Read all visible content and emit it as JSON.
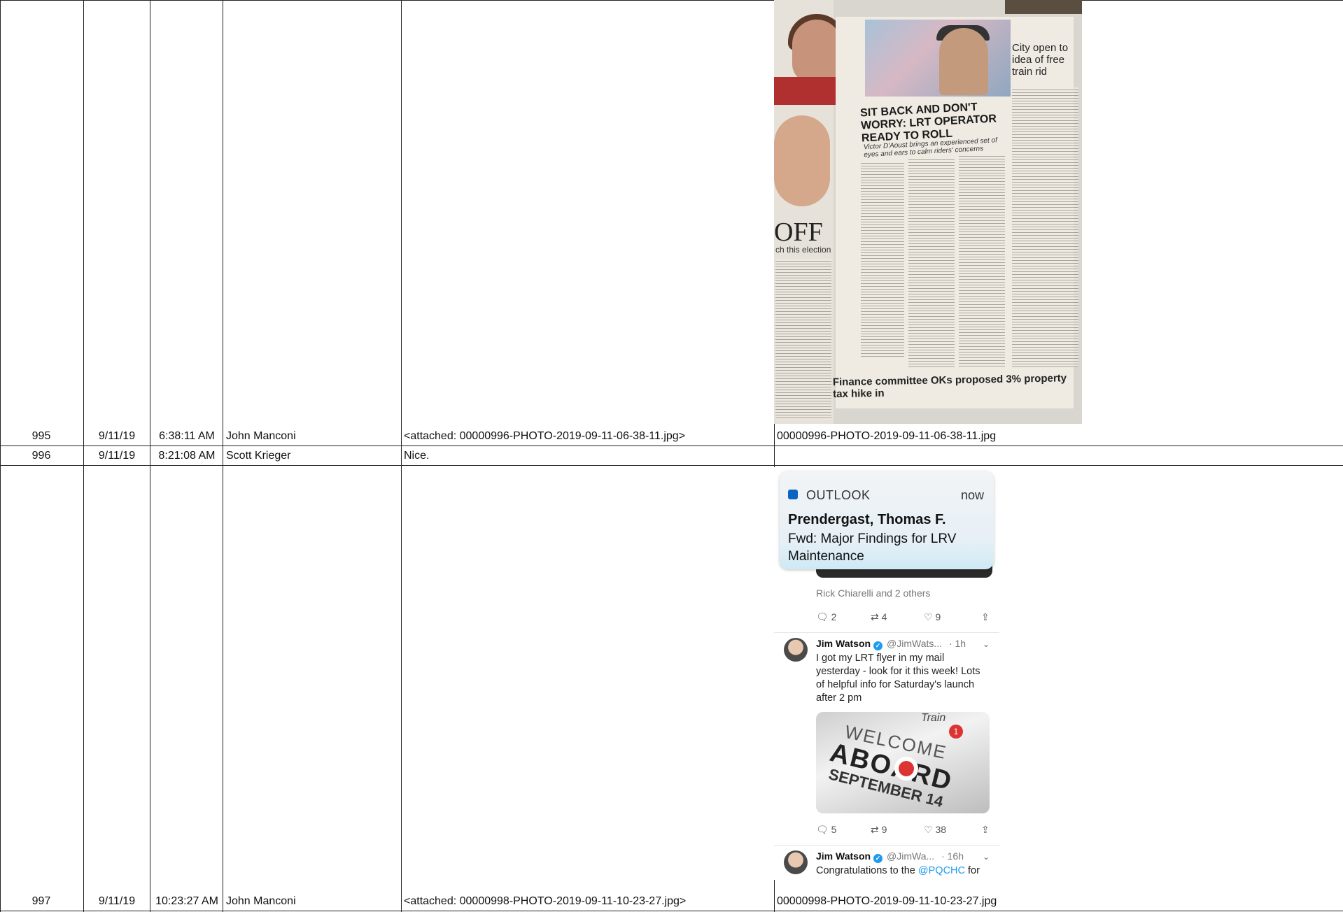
{
  "rows": [
    {
      "number": "995",
      "date": "9/11/19",
      "time": "6:38:11 AM",
      "sender": "John Manconi",
      "message": "<attached: 00000996-PHOTO-2019-09-11-06-38-11.jpg>",
      "attachment": "00000996-PHOTO-2019-09-11-06-38-11.jpg"
    },
    {
      "number": "996",
      "date": "9/11/19",
      "time": "8:21:08 AM",
      "sender": "Scott Krieger",
      "message": "Nice.",
      "attachment": ""
    },
    {
      "number": "997",
      "date": "9/11/19",
      "time": "10:23:27 AM",
      "sender": "John Manconi",
      "message": "<attached: 00000998-PHOTO-2019-09-11-10-23-27.jpg>",
      "attachment": "00000998-PHOTO-2019-09-11-10-23-27.jpg"
    }
  ],
  "newspaper": {
    "headline": "SIT BACK AND DON'T WORRY: LRT OPERATOR READY TO ROLL",
    "subhead": "Victor D'Aoust brings an experienced set of eyes and ears to calm riders' concerns",
    "right_headline": "City open to idea of free train rid",
    "left_fragment": "OFF",
    "left_sub": "ch this election",
    "bottom_headline": "Finance committee OKs proposed 3% property tax hike in"
  },
  "phone": {
    "notification": {
      "app": "OUTLOOK",
      "time": "now",
      "sender": "Prendergast, Thomas F.",
      "subject": "Fwd: Major Findings for LRV Maintenance"
    },
    "liked_by": "Rick Chiarelli and 2 others",
    "first_actions": {
      "replies": "2",
      "retweets": "4",
      "likes": "9"
    },
    "tweet1": {
      "name": "Jim Watson",
      "handle": "@JimWats...",
      "age": "· 1h",
      "text": "I got my LRT flyer in my mail yesterday - look for it this week! Lots of helpful info for Saturday's launch after 2 pm",
      "image_words": [
        "WELCOME",
        "ABOARD",
        "SEPTEMBER 14"
      ],
      "image_badge": "1",
      "image_title": "Train",
      "replies": "5",
      "retweets": "9",
      "likes": "38"
    },
    "tweet2": {
      "name": "Jim Watson",
      "handle": "@JimWa...",
      "age": "· 16h",
      "text_prefix": "Congratulations to the ",
      "mention": "@PQCHC",
      "text_suffix": " for"
    }
  },
  "colors": {
    "grid": "#222222",
    "outlook_blue": "#0a64c2",
    "twitter_blue": "#1d9bf0"
  }
}
